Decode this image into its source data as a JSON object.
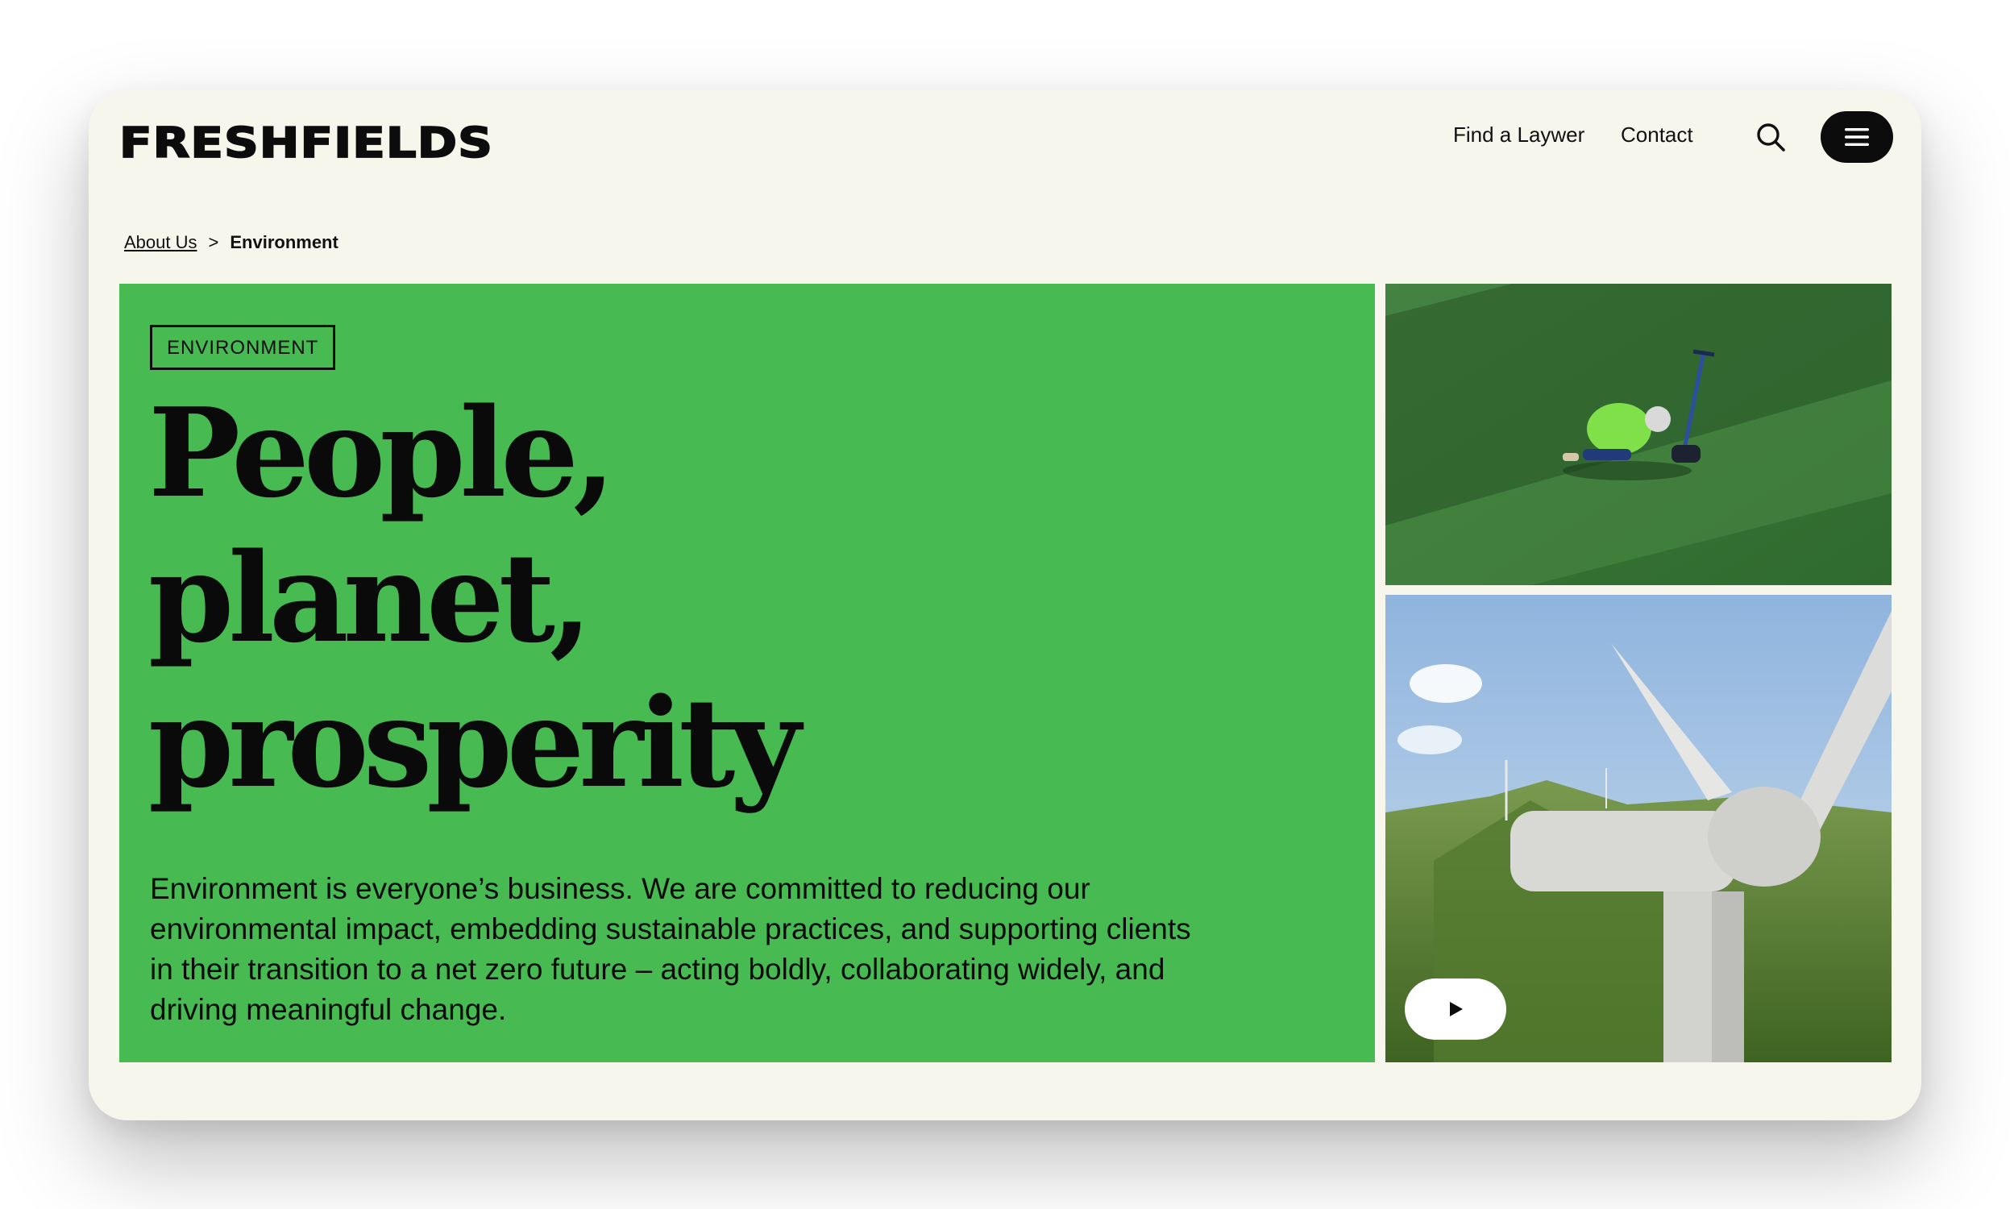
{
  "header": {
    "logo": "FRESHFIELDS",
    "nav": {
      "find_lawyer": "Find a Laywer",
      "contact": "Contact"
    },
    "search_icon": "search-icon",
    "menu_icon": "hamburger-menu-icon"
  },
  "breadcrumb": {
    "parent": "About Us",
    "separator": ">",
    "current": "Environment"
  },
  "hero": {
    "tag": "ENVIRONMENT",
    "headline_line1": "People, planet,",
    "headline_line2": "prosperity",
    "body": "Environment is everyone’s business. We are committed to reducing our environmental impact, embedding sustainable practices, and supporting clients in their transition to a net zero future – acting boldly, collaborating widely, and driving meaningful change."
  },
  "media": {
    "play_icon": "play-icon"
  },
  "colors": {
    "page_background": "#f6f6ec",
    "hero_green": "#47ba52",
    "text_dark": "#0c0c0c"
  }
}
